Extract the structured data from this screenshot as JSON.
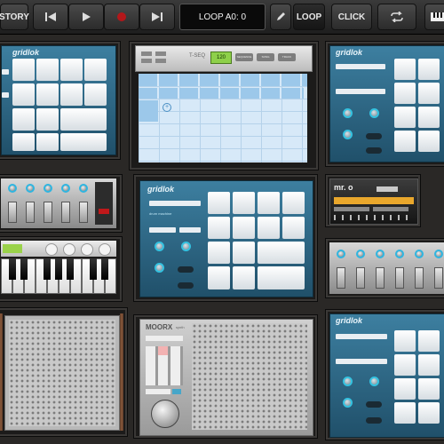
{
  "toolbar": {
    "story_label": "STORY",
    "display_text": "LOOP A0: 0",
    "loop_label": "LOOP",
    "click_label": "CLICK"
  },
  "gridlok": {
    "logo": "gridlok",
    "tagline": "drum machine"
  },
  "sequencer": {
    "title": "T-SEQ",
    "display_value": "120",
    "tabs": [
      "SEQUENCE",
      "SONG",
      "TRACK"
    ]
  },
  "mr_o": {
    "logo": "mr. o",
    "tagline": "sampler"
  },
  "moorx": {
    "logo": "MOORX",
    "tagline": "synth"
  },
  "colors": {
    "accent": "#34c2e0",
    "panel_blue": "#2e6a88",
    "record": "#c0181a",
    "wood": "#8a5a3c"
  }
}
